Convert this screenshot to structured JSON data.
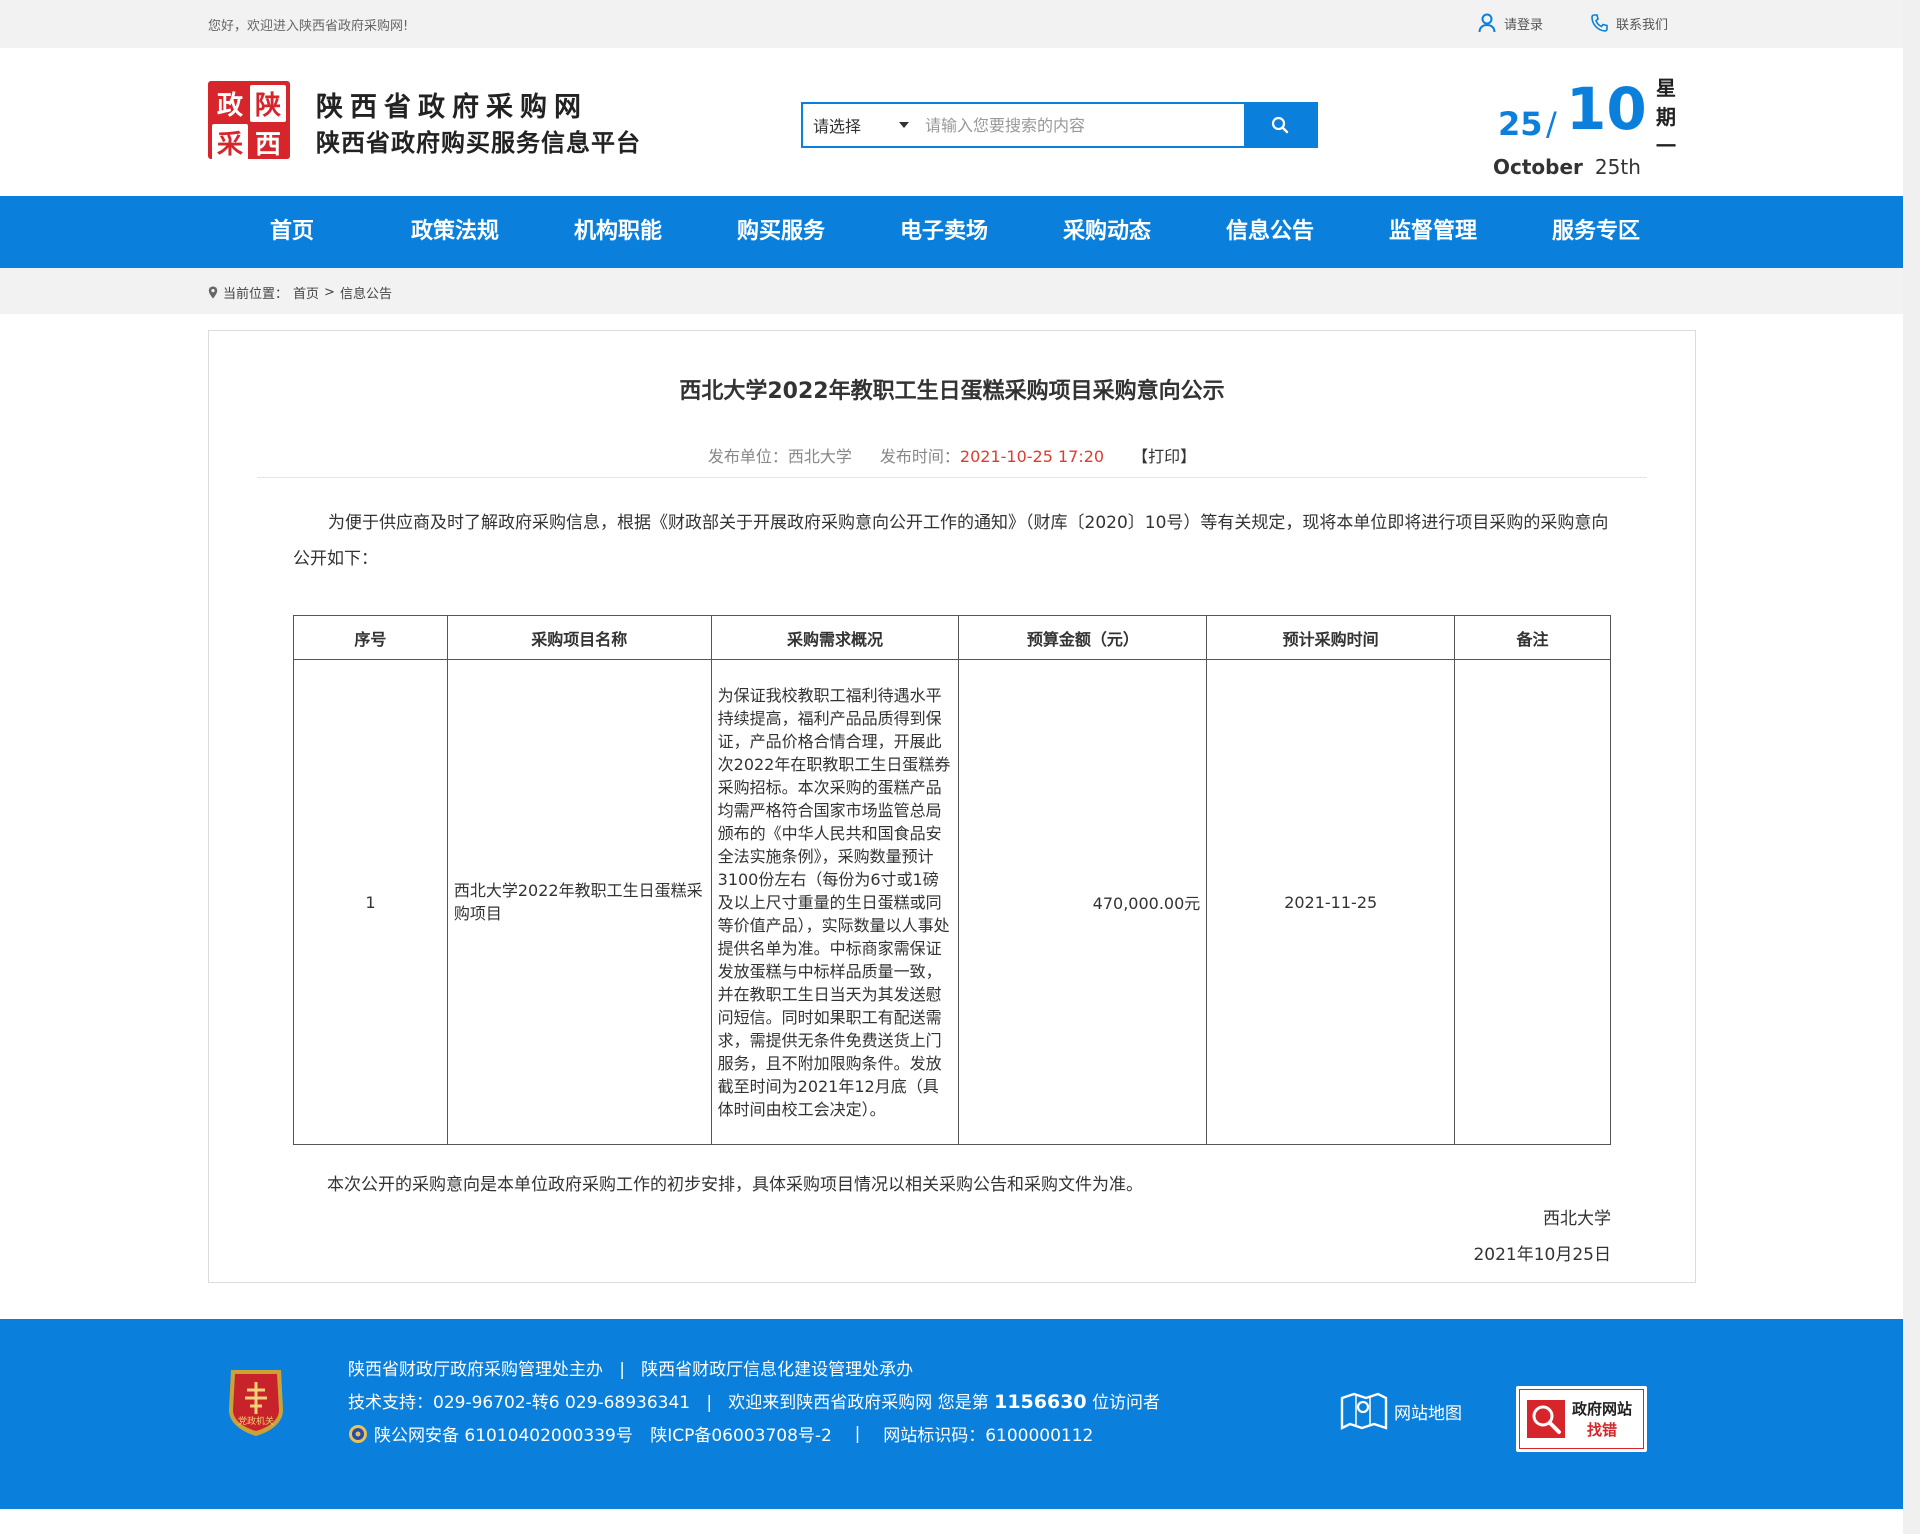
{
  "topbar": {
    "welcome": "您好，欢迎进入陕西省政府采购网!",
    "login": "请登录",
    "contact": "联系我们"
  },
  "header": {
    "logo_chars": [
      "政",
      "陕",
      "采",
      "西"
    ],
    "title": "陕西省政府采购网",
    "subtitle": "陕西省政府购买服务信息平台"
  },
  "search": {
    "select_label": "请选择",
    "placeholder": "请输入您要搜索的内容"
  },
  "date": {
    "day": "25",
    "slash": "/",
    "month": "10",
    "weekday": [
      "星",
      "期",
      "一"
    ],
    "month_en": "October",
    "day_en": "25th"
  },
  "nav": {
    "items": [
      "首页",
      "政策法规",
      "机构职能",
      "购买服务",
      "电子卖场",
      "采购动态",
      "信息公告",
      "监督管理",
      "服务专区"
    ]
  },
  "breadcrumb": {
    "label": "当前位置：",
    "home": "首页",
    "sep": ">",
    "current": "信息公告"
  },
  "article": {
    "title": "西北大学2022年教职工生日蛋糕采购项目采购意向公示",
    "publisher_label": "发布单位：",
    "publisher": "西北大学",
    "time_label": "发布时间：",
    "time": "2021-10-25 17:20",
    "print": "【打印】",
    "intro": "为便于供应商及时了解政府采购信息，根据《财政部关于开展政府采购意向公开工作的通知》（财库〔2020〕10号）等有关规定，现将本单位即将进行项目采购的采购意向公开如下：",
    "table": {
      "headers": [
        "序号",
        "采购项目名称",
        "采购需求概况",
        "预算金额（元）",
        "预计采购时间",
        "备注"
      ],
      "rows": [
        {
          "no": "1",
          "name": "西北大学2022年教职工生日蛋糕采购项目",
          "desc": "为保证我校教职工福利待遇水平持续提高，福利产品品质得到保证，产品价格合情合理，开展此次2022年在职教职工生日蛋糕券采购招标。本次采购的蛋糕产品均需严格符合国家市场监管总局颁布的《中华人民共和国食品安全法实施条例》，采购数量预计3100份左右（每份为6寸或1磅及以上尺寸重量的生日蛋糕或同等价值产品），实际数量以人事处提供名单为准。中标商家需保证发放蛋糕与中标样品质量一致，并在教职工生日当天为其发送慰问短信。同时如果职工有配送需求，需提供无条件免费送货上门服务，且不附加限购条件。发放截至时间为2021年12月底（具体时间由校工会决定）。",
          "budget": "470,000.00元",
          "time": "2021-11-25",
          "note": ""
        }
      ]
    },
    "closing": "本次公开的采购意向是本单位政府采购工作的初步安排，具体采购项目情况以相关采购公告和采购文件为准。",
    "sign_org": "西北大学",
    "sign_date": "2021年10月25日"
  },
  "footer": {
    "line1_a": "陕西省财政厅政府采购管理处主办",
    "line1_sep": "|",
    "line1_b": "陕西省财政厅信息化建设管理处承办",
    "support": "技术支持：029-96702-转6 029-68936341",
    "visit_pre": "欢迎来到陕西省政府采购网 您是第",
    "visit_count": "1156630",
    "visit_post": "位访问者",
    "beian": "陕公网安备 61010402000339号",
    "icp": "陕ICP备06003708号-2",
    "site_id": "网站标识码：6100000112",
    "emblem_text": "党政机关",
    "sitemap": "网站地图",
    "find_t1": "政府网站",
    "find_t2": "找错"
  },
  "colors": {
    "brand_blue": "#0a7fdc",
    "logo_red": "#d7262b",
    "time_red": "#e23b2e"
  }
}
